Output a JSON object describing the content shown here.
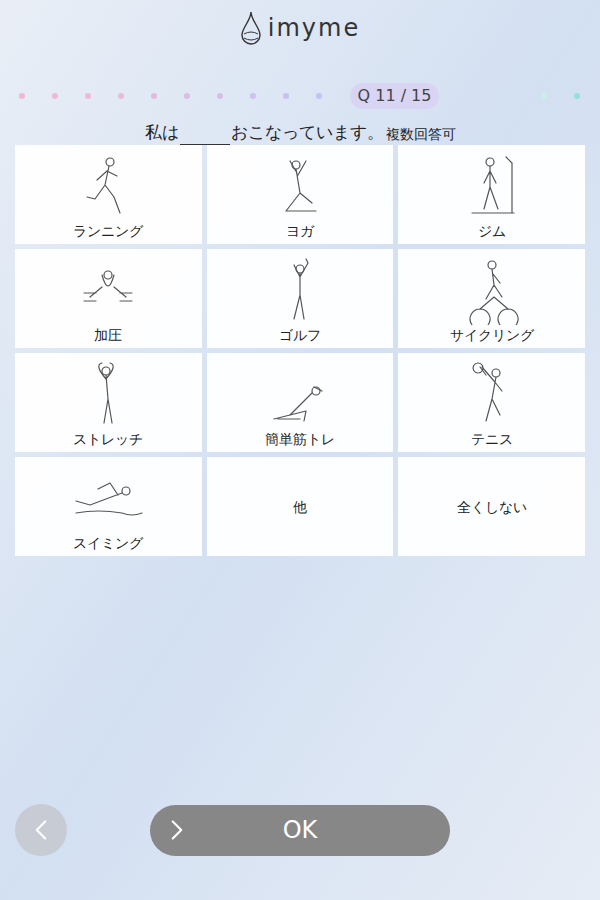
{
  "header": {
    "logo_text": "imyme"
  },
  "progress": {
    "label": "Q 11 / 15",
    "dots_before": [
      {
        "color": "#f2b8cf"
      },
      {
        "color": "#efb8d2"
      },
      {
        "color": "#ebb9d6"
      },
      {
        "color": "#e6bada"
      },
      {
        "color": "#e1bbdf"
      },
      {
        "color": "#dbbce4"
      },
      {
        "color": "#d6bde8"
      },
      {
        "color": "#d1bfee"
      },
      {
        "color": "#cbbff2"
      },
      {
        "color": "#c5c0f5"
      }
    ],
    "dots_after": [
      {
        "color": "#c9efe6"
      },
      {
        "color": "#8fe3d4"
      }
    ]
  },
  "question": {
    "before": "私は",
    "after": "おこなっています。",
    "note": "複数回答可"
  },
  "options": [
    {
      "label": "ランニング",
      "kind": "icon",
      "selected": false
    },
    {
      "label": "ヨガ",
      "kind": "icon",
      "selected": false
    },
    {
      "label": "ジム",
      "kind": "icon",
      "selected": false
    },
    {
      "label": "加圧",
      "kind": "icon",
      "selected": false
    },
    {
      "label": "ゴルフ",
      "kind": "icon",
      "selected": false
    },
    {
      "label": "サイクリング",
      "kind": "icon",
      "selected": false
    },
    {
      "label": "ストレッチ",
      "kind": "icon",
      "selected": false
    },
    {
      "label": "簡単筋トレ",
      "kind": "icon",
      "selected": false
    },
    {
      "label": "テニス",
      "kind": "icon",
      "selected": false
    },
    {
      "label": "スイミング",
      "kind": "icon",
      "selected": false
    },
    {
      "label": "他",
      "kind": "text",
      "selected": false
    },
    {
      "label": "全くしない",
      "kind": "text",
      "selected": false
    }
  ],
  "buttons": {
    "ok": "OK"
  }
}
